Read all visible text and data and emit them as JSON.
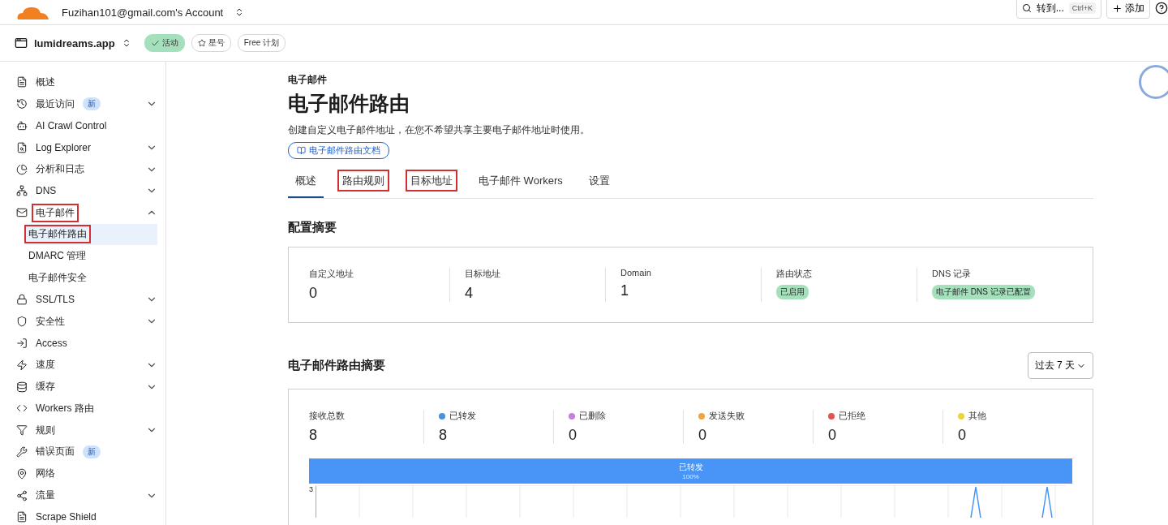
{
  "topbar": {
    "account": "Fuzihan101@gmail.com's Account",
    "search": {
      "placeholder": "转到...",
      "shortcut": "Ctrl+K"
    },
    "add_button": "添加"
  },
  "zonebar": {
    "domain": "lumidreams.app",
    "status": "活动",
    "star": "星号",
    "plan": "Free 计划"
  },
  "sidebar": {
    "items": [
      {
        "label": "概述",
        "selected": false,
        "highlighted": false
      },
      {
        "label": "最近访问",
        "badge": "新",
        "expanded": false,
        "selected": false,
        "highlighted": false
      },
      {
        "label": "AI Crawl Control",
        "selected": false,
        "highlighted": false
      },
      {
        "label": "Log Explorer",
        "expanded": false,
        "selected": false,
        "highlighted": false
      },
      {
        "label": "分析和日志",
        "expanded": false,
        "selected": false,
        "highlighted": false
      },
      {
        "label": "DNS",
        "expanded": false,
        "selected": false,
        "highlighted": false
      },
      {
        "label": "电子邮件",
        "expanded": true,
        "selected": false,
        "highlighted": true,
        "children": [
          {
            "label": "电子邮件路由",
            "selected": true,
            "highlighted": true
          },
          {
            "label": "DMARC 管理",
            "selected": false,
            "highlighted": false
          },
          {
            "label": "电子邮件安全",
            "selected": false,
            "highlighted": false
          }
        ]
      },
      {
        "label": "SSL/TLS",
        "expanded": false,
        "selected": false,
        "highlighted": false
      },
      {
        "label": "安全性",
        "expanded": false,
        "selected": false,
        "highlighted": false
      },
      {
        "label": "Access",
        "selected": false,
        "highlighted": false
      },
      {
        "label": "速度",
        "expanded": false,
        "selected": false,
        "highlighted": false
      },
      {
        "label": "缓存",
        "expanded": false,
        "selected": false,
        "highlighted": false
      },
      {
        "label": "Workers 路由",
        "selected": false,
        "highlighted": false
      },
      {
        "label": "规则",
        "expanded": false,
        "selected": false,
        "highlighted": false
      },
      {
        "label": "错误页面",
        "badge": "新",
        "selected": false,
        "highlighted": false
      },
      {
        "label": "网络",
        "selected": false,
        "highlighted": false
      },
      {
        "label": "流量",
        "expanded": false,
        "selected": false,
        "highlighted": false
      },
      {
        "label": "Scrape Shield",
        "selected": false,
        "highlighted": false
      }
    ]
  },
  "page": {
    "breadcrumb": "电子邮件",
    "title": "电子邮件路由",
    "description": "创建自定义电子邮件地址，在您不希望共享主要电子邮件地址时使用。",
    "docs_link": "电子邮件路由文档"
  },
  "tabs": [
    {
      "label": "概述",
      "selected": true,
      "highlighted": false
    },
    {
      "label": "路由规则",
      "selected": false,
      "highlighted": true
    },
    {
      "label": "目标地址",
      "selected": false,
      "highlighted": true
    },
    {
      "label": "电子邮件 Workers",
      "selected": false,
      "highlighted": false
    },
    {
      "label": "设置",
      "selected": false,
      "highlighted": false
    }
  ],
  "config_summary": {
    "title": "配置摘要",
    "items": [
      {
        "label": "自定义地址",
        "kind": "number",
        "value": "0"
      },
      {
        "label": "目标地址",
        "kind": "number",
        "value": "4"
      },
      {
        "label": "Domain",
        "kind": "number",
        "value": "1"
      },
      {
        "label": "路由状态",
        "kind": "pill",
        "value": "已启用"
      },
      {
        "label": "DNS 记录",
        "kind": "pill",
        "value": "电子邮件 DNS 记录已配置"
      }
    ]
  },
  "routing_summary": {
    "title": "电子邮件路由摘要",
    "range": "过去 7 天",
    "metrics": [
      {
        "label": "接收总数",
        "value": "8"
      },
      {
        "label": "已转发",
        "value": "8",
        "color": "#4a90e2"
      },
      {
        "label": "已删除",
        "value": "0",
        "color": "#c77ddb"
      },
      {
        "label": "发送失败",
        "value": "0",
        "color": "#f0a63c"
      },
      {
        "label": "已拒绝",
        "value": "0",
        "color": "#e5534b"
      },
      {
        "label": "其他",
        "value": "0",
        "color": "#f2d23a"
      }
    ],
    "share_bar": {
      "label": "已转发",
      "percent": "100%",
      "level": 1
    },
    "chart": {
      "top_tick": "3"
    }
  }
}
